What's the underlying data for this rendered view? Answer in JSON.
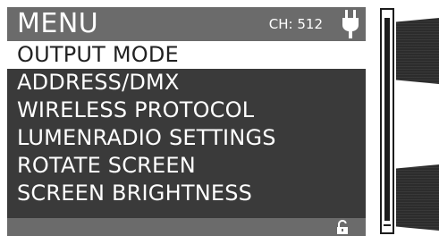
{
  "header": {
    "title": "MENU",
    "channel": "CH: 512",
    "power_icon": "plug-icon"
  },
  "menu": {
    "items": [
      {
        "label": "OUTPUT MODE",
        "selected": true
      },
      {
        "label": "ADDRESS/DMX",
        "selected": false
      },
      {
        "label": "WIRELESS PROTOCOL",
        "selected": false
      },
      {
        "label": "LUMENRADIO SETTINGS",
        "selected": false
      },
      {
        "label": "ROTATE SCREEN",
        "selected": false
      },
      {
        "label": "SCREEN BRIGHTNESS",
        "selected": false
      }
    ]
  },
  "footer": {
    "lock_icon": "unlocked-padlock-icon"
  },
  "colors": {
    "header_bg": "#6b6b6b",
    "list_bg": "#3a3a3a",
    "selected_bg": "#ffffff",
    "text": "#ffffff",
    "selected_text": "#222222"
  }
}
